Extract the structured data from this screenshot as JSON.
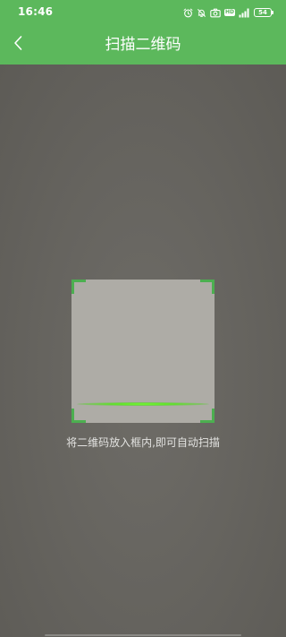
{
  "status_bar": {
    "time": "16:46",
    "battery_level": "54",
    "hd_label": "HD",
    "icons": [
      "alarm-icon",
      "mute-bell-icon",
      "camera-icon",
      "hd-icon",
      "signal-icon",
      "battery-icon"
    ]
  },
  "header": {
    "title": "扫描二维码",
    "back_icon": "chevron-left-icon",
    "background_color": "#5cb85c"
  },
  "scanner": {
    "hint": "将二维码放入框内,即可自动扫描",
    "frame_color": "#4caf50",
    "scan_line_color": "#7dff3a"
  }
}
